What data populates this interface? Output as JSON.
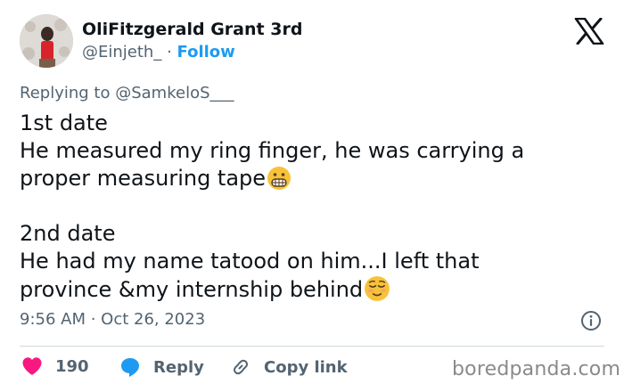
{
  "author": {
    "name": "OliFitzgerald Grant 3rd",
    "handle": "@Einjeth_",
    "separator": "·",
    "follow_label": "Follow"
  },
  "reply": {
    "prefix": "Replying to",
    "mention": "@SamkeloS___"
  },
  "tweet": {
    "line1": "1st date",
    "line2": "He measured my ring finger, he was carrying a",
    "line3": "proper measuring tape",
    "line3_emoji": "grimacing-face-emoji",
    "line4": "2nd date",
    "line5": "He had my name tatood on him...I left that",
    "line6": "province &my internship behind",
    "line6_emoji": "relieved-face-emoji"
  },
  "meta": {
    "timestamp": "9:56 AM · Oct 26, 2023"
  },
  "actions": {
    "like_count": "190",
    "reply_label": "Reply",
    "copy_label": "Copy link"
  },
  "watermark": "boredpanda.com",
  "colors": {
    "accent": "#1d9bf0",
    "like": "#f91880",
    "muted": "#536471",
    "text": "#0f1419"
  },
  "icons": [
    "x-logo-icon",
    "info-icon",
    "heart-icon",
    "reply-bubble-icon",
    "link-icon"
  ]
}
